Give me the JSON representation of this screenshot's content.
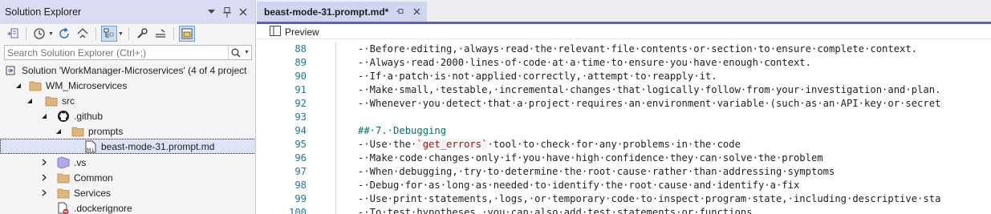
{
  "solution_explorer": {
    "title": "Solution Explorer",
    "search_placeholder": "Search Solution Explorer (Ctrl+;)",
    "tree": [
      {
        "label": "Solution 'WorkManager-Microservices' (4 of 4 project",
        "icon": "solution-icon"
      },
      {
        "label": "WM_Microservices",
        "icon": "folder-icon"
      },
      {
        "label": "src",
        "icon": "folder-icon"
      },
      {
        "label": ".github",
        "icon": "github-icon"
      },
      {
        "label": "prompts",
        "icon": "folder-icon"
      },
      {
        "label": "beast-mode-31.prompt.md",
        "icon": "markdown-file-icon"
      },
      {
        "label": ".vs",
        "icon": "vs-icon"
      },
      {
        "label": "Common",
        "icon": "folder-icon"
      },
      {
        "label": "Services",
        "icon": "folder-icon"
      },
      {
        "label": ".dockerignore",
        "icon": "file-blocked-icon"
      }
    ]
  },
  "editor": {
    "tab_label": "beast-mode-31.prompt.md*",
    "preview_label": "Preview",
    "lines": [
      {
        "num": "88",
        "text": "-·Before·editing,·always·read·the·relevant·file·contents·or·section·to·ensure·complete·context."
      },
      {
        "num": "89",
        "text": "-·Always·read·2000·lines·of·code·at·a·time·to·ensure·you·have·enough·context."
      },
      {
        "num": "90",
        "text": "-·If·a·patch·is·not·applied·correctly,·attempt·to·reapply·it."
      },
      {
        "num": "91",
        "text": "-·Make·small,·testable,·incremental·changes·that·logically·follow·from·your·investigation·and·plan."
      },
      {
        "num": "92",
        "text": "-·Whenever·you·detect·that·a·project·requires·an·environment·variable·(such·as·an·API·key·or·secret"
      },
      {
        "num": "93",
        "text": ""
      },
      {
        "num": "94",
        "text": "##·7.·Debugging"
      },
      {
        "num": "95",
        "text_pre": "-·Use·the·",
        "code": "`get_errors`",
        "text_post": "·tool·to·check·for·any·problems·in·the·code"
      },
      {
        "num": "96",
        "text": "-·Make·code·changes·only·if·you·have·high·confidence·they·can·solve·the·problem"
      },
      {
        "num": "97",
        "text": "-·When·debugging,·try·to·determine·the·root·cause·rather·than·addressing·symptoms"
      },
      {
        "num": "98",
        "text": "-·Debug·for·as·long·as·needed·to·identify·the·root·cause·and·identify·a·fix"
      },
      {
        "num": "99",
        "text": "-·Use·print·statements,·logs,·or·temporary·code·to·inspect·program·state,·including·descriptive·sta"
      },
      {
        "num": "100",
        "text": "-·To·test·hypotheses,·you·can·also·add·test·statements·or·functions"
      }
    ]
  },
  "colors": {
    "accent": "#5b5fc7",
    "title_bar": "#dbdcf3",
    "line_number": "#237893"
  }
}
